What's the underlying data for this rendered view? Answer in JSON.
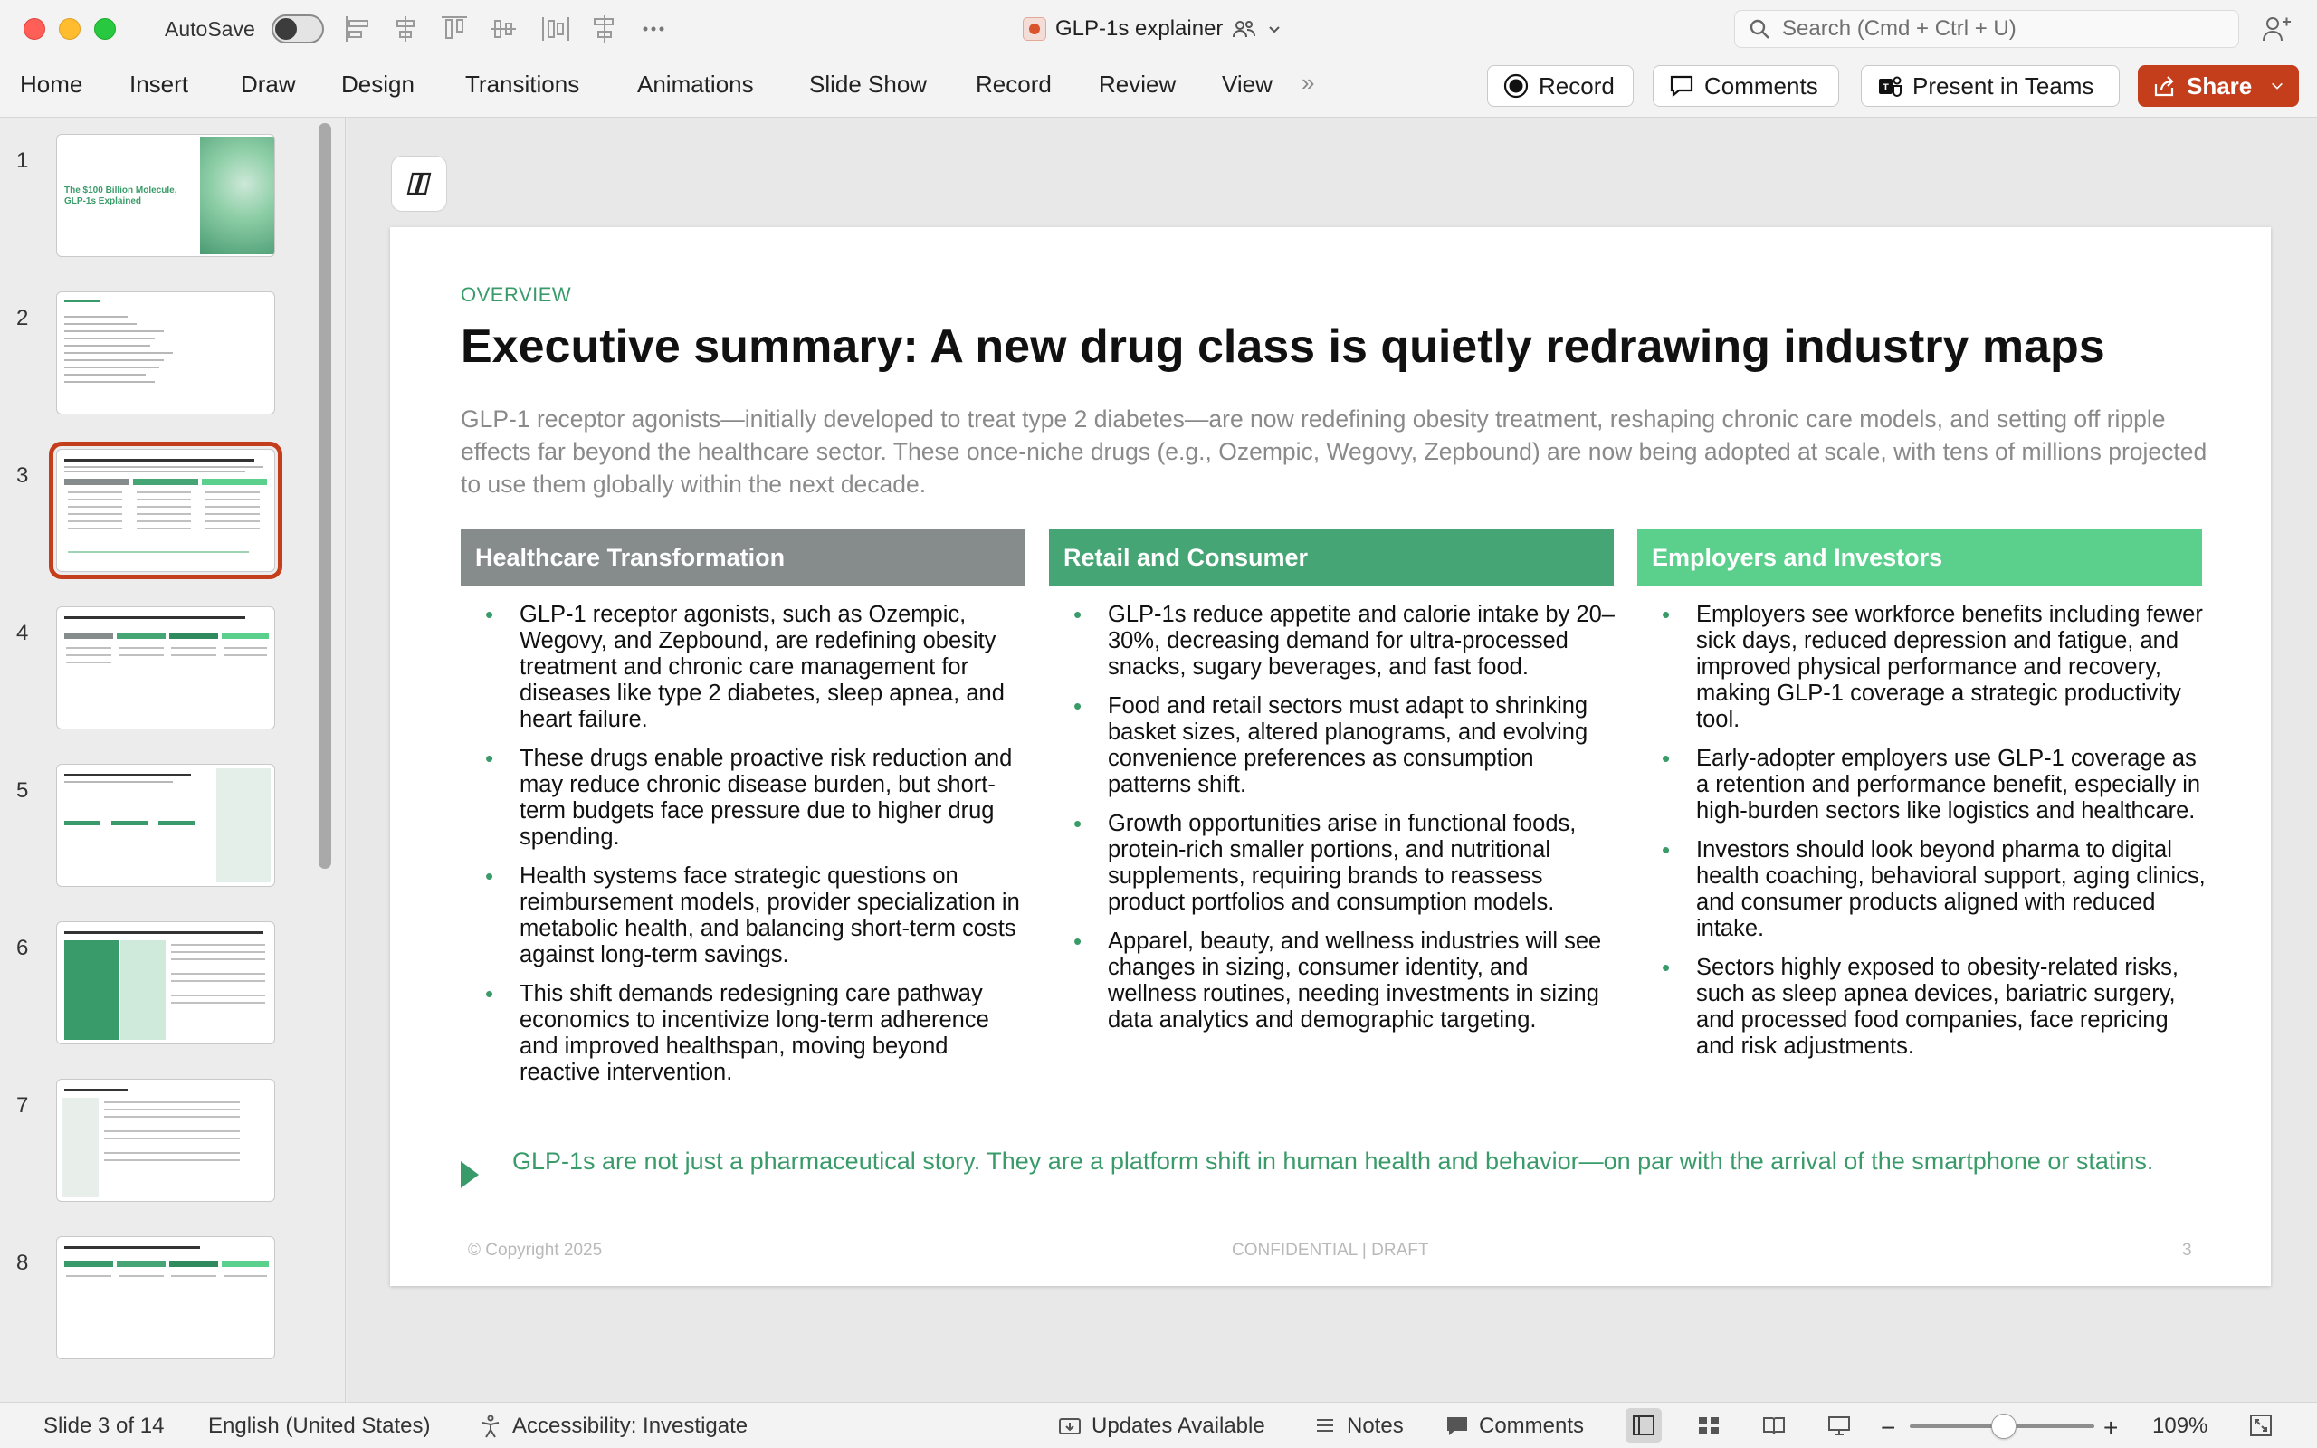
{
  "titlebar": {
    "autosave_label": "AutoSave",
    "autosave_on": false,
    "document_title": "GLP-1s explainer",
    "search_placeholder": "Search (Cmd + Ctrl + U)"
  },
  "ribbon": {
    "tabs": [
      "Home",
      "Insert",
      "Draw",
      "Design",
      "Transitions",
      "Animations",
      "Slide Show",
      "Record",
      "Review",
      "View"
    ],
    "more": "»",
    "record_label": "Record",
    "comments_label": "Comments",
    "present_label": "Present in Teams",
    "share_label": "Share",
    "share_color": "#c43e1c"
  },
  "thumbnails": [
    "1",
    "2",
    "3",
    "4",
    "5",
    "6",
    "7",
    "8"
  ],
  "thumbnail_1_title": "The $100 Billion Molecule, GLP-1s Explained",
  "selected_slide": 3,
  "slide": {
    "eyebrow": "OVERVIEW",
    "title": "Executive summary: A new drug class is quietly redrawing industry maps",
    "intro": "GLP-1 receptor agonists—initially developed to treat type 2 diabetes—are now redefining obesity treatment, reshaping chronic care models, and setting off ripple effects far beyond the healthcare sector. These once-niche drugs (e.g., Ozempic, Wegovy, Zepbound) are now being adopted at scale, with tens of millions projected to use them globally within the next decade.",
    "columns": [
      {
        "heading": "Healthcare Transformation",
        "color": "#868c8c",
        "bullets": [
          "GLP-1 receptor agonists, such as Ozempic, Wegovy, and Zepbound, are redefining obesity treatment and chronic care management for diseases like type 2 diabetes, sleep apnea, and heart failure.",
          "These drugs enable proactive risk reduction and may reduce chronic disease burden, but short-term budgets face pressure due to higher drug spending.",
          "Health systems face strategic questions on reimbursement models, provider specialization in metabolic health, and balancing short-term costs against long-term savings.",
          "This shift demands redesigning care pathway economics to incentivize long-term adherence and improved healthspan, moving beyond reactive intervention."
        ]
      },
      {
        "heading": "Retail and Consumer",
        "color": "#45a574",
        "bullets": [
          "GLP-1s reduce appetite and calorie intake by 20–30%, decreasing demand for ultra-processed snacks, sugary beverages, and fast food.",
          "Food and retail sectors must adapt to shrinking basket sizes, altered planograms, and evolving convenience preferences as consumption patterns shift.",
          "Growth opportunities arise in functional foods, protein-rich smaller portions, and nutritional supplements, requiring brands to reassess product portfolios and consumption models.",
          "Apparel, beauty, and wellness industries will see changes in sizing, consumer identity, and wellness routines, needing investments in sizing data analytics and demographic targeting."
        ]
      },
      {
        "heading": "Employers and Investors",
        "color": "#5bcf8c",
        "bullets": [
          "Employers see workforce benefits including fewer sick days, reduced depression and fatigue, and improved physical performance and recovery, making GLP-1 coverage a strategic productivity tool.",
          "Early-adopter employers use GLP-1 coverage as a retention and performance benefit, especially in high-burden sectors like logistics and healthcare.",
          "Investors should look beyond pharma to digital health coaching, behavioral support, aging clinics, and consumer products aligned with reduced intake.",
          "Sectors highly exposed to obesity-related risks, such as sleep apnea devices, bariatric surgery, and processed food companies, face repricing and risk adjustments."
        ]
      }
    ],
    "callout": "GLP-1s are not just a pharmaceutical story. They are a platform shift in human health and behavior—on par with the arrival of the smartphone or statins.",
    "footer_left": "© Copyright 2025",
    "footer_center": "CONFIDENTIAL | DRAFT",
    "footer_right": "3",
    "accent": "#3a9b6a"
  },
  "statusbar": {
    "slide_info": "Slide 3 of 14",
    "language": "English (United States)",
    "accessibility": "Accessibility: Investigate",
    "updates": "Updates Available",
    "notes": "Notes",
    "comments": "Comments",
    "zoom_minus": "−",
    "zoom_plus": "+",
    "zoom_level": "109%"
  }
}
